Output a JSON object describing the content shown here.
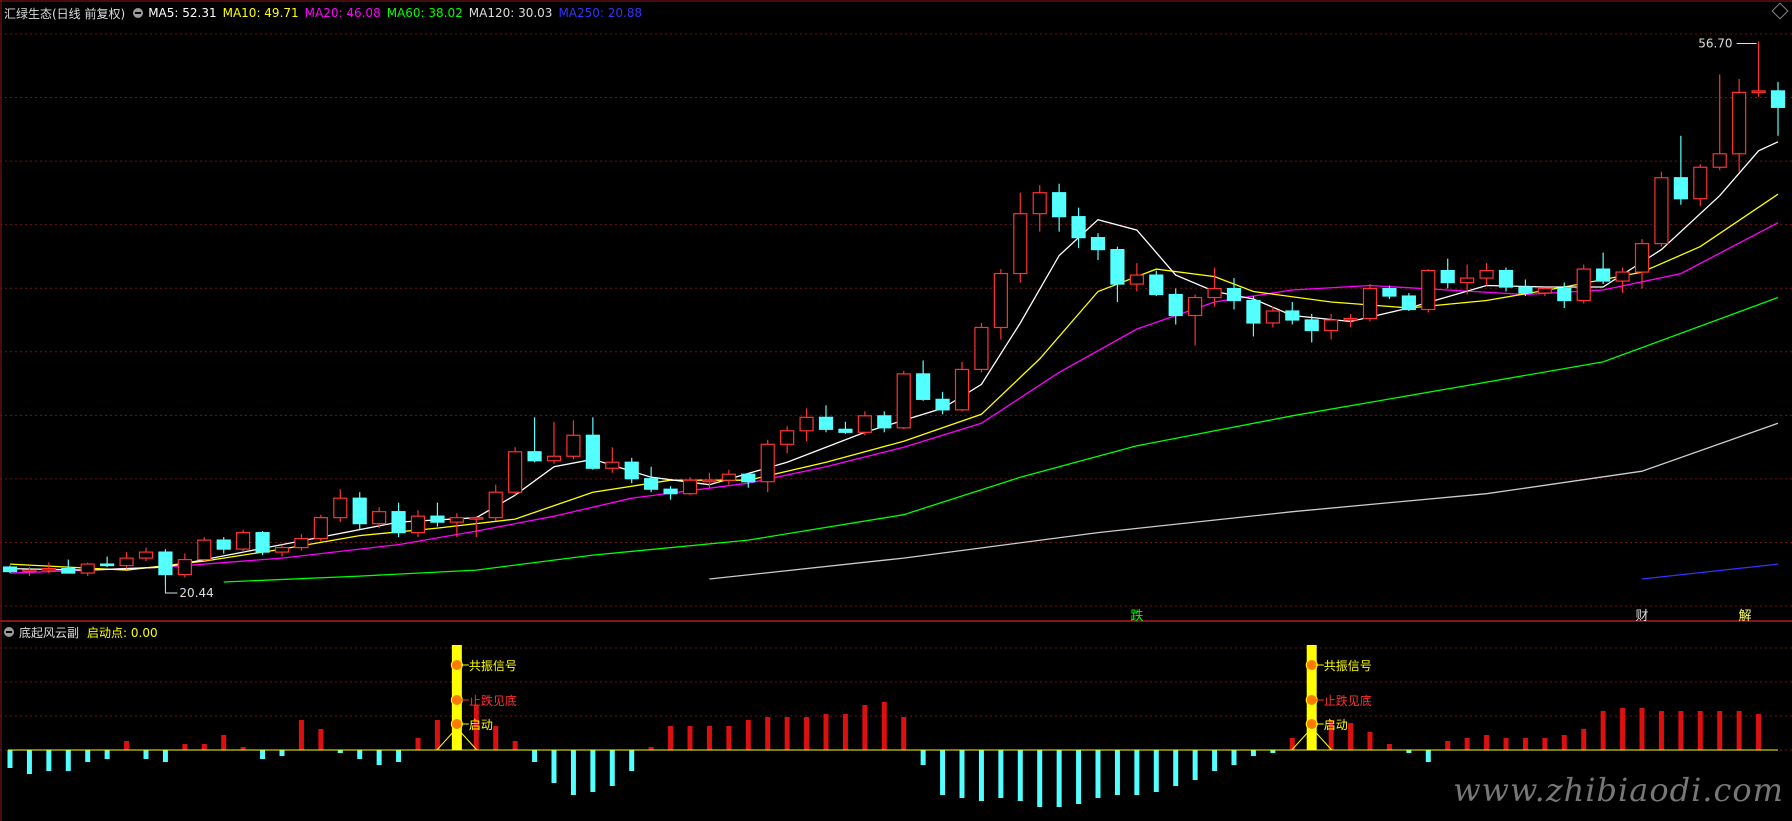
{
  "main_panel": {
    "stock_name": "汇绿生态(日线 前复权)",
    "ma_values": [
      {
        "label": "MA5: 52.31",
        "color": "#ffffff"
      },
      {
        "label": "MA10: 49.71",
        "color": "#ffff00"
      },
      {
        "label": "MA20: 46.08",
        "color": "#ff00ff"
      },
      {
        "label": "MA60: 38.02",
        "color": "#00ff00"
      },
      {
        "label": "MA120: 30.03",
        "color": "#dddddd"
      },
      {
        "label": "MA250: 20.88",
        "color": "#3333ff"
      }
    ],
    "high_label": "56.70",
    "low_label": "20.44",
    "event_markers": [
      "跌",
      "财",
      "解"
    ]
  },
  "sub_panel": {
    "indicator_name": "底起风云副",
    "start_point_label": "启动点: 0.00",
    "signal_labels": [
      "共振信号",
      "止跌见底",
      "启动"
    ]
  },
  "watermark": "www.zhibiaodi.com",
  "colors": {
    "up": "#ff3232",
    "down": "#54ffff",
    "ma5": "#ffffff",
    "ma10": "#ffff00",
    "ma20": "#ff00ff",
    "ma60": "#00ff00",
    "ma120": "#cccccc",
    "ma250": "#3333ff",
    "grid": "#6e1515"
  },
  "chart_data": {
    "type": "candlestick",
    "y_range": [
      19,
      58
    ],
    "candles": [
      [
        21.6,
        21.7,
        21.2,
        21.3
      ],
      [
        21.3,
        21.6,
        21.0,
        21.4
      ],
      [
        21.4,
        21.9,
        21.2,
        21.5
      ],
      [
        21.5,
        22.1,
        21.3,
        21.2
      ],
      [
        21.2,
        21.9,
        21.0,
        21.8
      ],
      [
        21.8,
        22.3,
        21.6,
        21.7
      ],
      [
        21.7,
        22.6,
        21.5,
        22.2
      ],
      [
        22.2,
        22.9,
        22.0,
        22.6
      ],
      [
        22.6,
        22.8,
        20.4,
        21.1
      ],
      [
        21.1,
        22.5,
        20.9,
        22.1
      ],
      [
        22.1,
        23.6,
        22.0,
        23.4
      ],
      [
        23.4,
        23.6,
        22.5,
        22.8
      ],
      [
        22.8,
        24.1,
        22.6,
        23.9
      ],
      [
        23.9,
        24.0,
        22.4,
        22.6
      ],
      [
        22.6,
        23.1,
        22.3,
        22.9
      ],
      [
        22.9,
        23.8,
        22.7,
        23.5
      ],
      [
        23.5,
        25.1,
        23.3,
        24.9
      ],
      [
        24.9,
        26.8,
        24.6,
        26.2
      ],
      [
        26.2,
        26.6,
        24.1,
        24.5
      ],
      [
        24.5,
        25.6,
        24.2,
        25.3
      ],
      [
        25.3,
        25.9,
        23.6,
        23.9
      ],
      [
        23.9,
        25.4,
        23.6,
        25.0
      ],
      [
        25.0,
        25.9,
        24.3,
        24.6
      ],
      [
        24.6,
        25.2,
        23.6,
        24.9
      ],
      [
        24.9,
        25.0,
        23.6,
        24.9
      ],
      [
        24.9,
        27.1,
        24.7,
        26.6
      ],
      [
        26.6,
        29.6,
        26.4,
        29.3
      ],
      [
        29.3,
        31.6,
        28.6,
        28.7
      ],
      [
        28.7,
        31.3,
        28.5,
        29.0
      ],
      [
        29.0,
        31.4,
        28.8,
        30.4
      ],
      [
        30.4,
        31.6,
        28.1,
        28.2
      ],
      [
        28.2,
        29.6,
        27.9,
        28.6
      ],
      [
        28.6,
        28.9,
        27.2,
        27.5
      ],
      [
        27.5,
        28.3,
        26.6,
        26.8
      ],
      [
        26.8,
        27.0,
        26.1,
        26.5
      ],
      [
        26.5,
        27.6,
        26.4,
        27.4
      ],
      [
        27.4,
        27.9,
        26.9,
        27.4
      ],
      [
        27.4,
        28.1,
        27.1,
        27.8
      ],
      [
        27.8,
        27.9,
        26.9,
        27.3
      ],
      [
        27.3,
        30.1,
        26.6,
        29.8
      ],
      [
        29.8,
        31.0,
        29.2,
        30.7
      ],
      [
        30.7,
        32.2,
        30.0,
        31.6
      ],
      [
        31.6,
        32.4,
        30.6,
        30.8
      ],
      [
        30.8,
        31.3,
        30.5,
        30.6
      ],
      [
        30.6,
        32.0,
        30.4,
        31.7
      ],
      [
        31.7,
        32.0,
        30.6,
        30.9
      ],
      [
        30.9,
        34.7,
        30.8,
        34.5
      ],
      [
        34.5,
        35.4,
        32.7,
        32.8
      ],
      [
        32.8,
        33.3,
        31.8,
        32.1
      ],
      [
        32.1,
        35.3,
        32.0,
        34.8
      ],
      [
        34.8,
        37.9,
        34.6,
        37.6
      ],
      [
        37.6,
        41.5,
        36.8,
        41.2
      ],
      [
        41.2,
        46.6,
        40.6,
        45.2
      ],
      [
        45.2,
        47.1,
        44.0,
        46.6
      ],
      [
        46.6,
        47.2,
        44.0,
        45.0
      ],
      [
        45.0,
        45.6,
        42.9,
        43.6
      ],
      [
        43.6,
        43.9,
        42.1,
        42.8
      ],
      [
        42.8,
        43.0,
        39.3,
        40.5
      ],
      [
        40.5,
        41.9,
        40.0,
        41.1
      ],
      [
        41.1,
        41.4,
        39.7,
        39.8
      ],
      [
        39.8,
        40.2,
        37.8,
        38.4
      ],
      [
        38.4,
        39.8,
        36.4,
        39.6
      ],
      [
        39.6,
        41.6,
        39.0,
        40.2
      ],
      [
        40.2,
        40.9,
        38.8,
        39.4
      ],
      [
        39.4,
        39.7,
        37.0,
        37.9
      ],
      [
        37.9,
        39.0,
        37.6,
        38.7
      ],
      [
        38.7,
        39.3,
        37.8,
        38.1
      ],
      [
        38.1,
        38.5,
        36.6,
        37.4
      ],
      [
        37.4,
        38.5,
        36.8,
        38.1
      ],
      [
        38.1,
        38.5,
        37.6,
        38.2
      ],
      [
        38.2,
        40.5,
        38.0,
        40.2
      ],
      [
        40.2,
        40.4,
        39.5,
        39.7
      ],
      [
        39.7,
        39.9,
        38.7,
        38.8
      ],
      [
        38.8,
        41.5,
        38.6,
        41.4
      ],
      [
        41.4,
        42.2,
        40.2,
        40.6
      ],
      [
        40.6,
        41.8,
        39.8,
        40.9
      ],
      [
        40.9,
        41.9,
        40.4,
        41.4
      ],
      [
        41.4,
        41.6,
        40.0,
        40.3
      ],
      [
        40.3,
        40.8,
        39.7,
        39.9
      ],
      [
        39.9,
        40.2,
        39.7,
        40.2
      ],
      [
        40.2,
        40.6,
        38.9,
        39.4
      ],
      [
        39.4,
        41.8,
        39.2,
        41.5
      ],
      [
        41.5,
        42.6,
        40.5,
        40.7
      ],
      [
        40.7,
        41.6,
        39.9,
        41.3
      ],
      [
        41.3,
        43.5,
        40.2,
        43.2
      ],
      [
        43.2,
        48.0,
        43.0,
        47.6
      ],
      [
        47.6,
        50.4,
        45.8,
        46.2
      ],
      [
        46.2,
        48.5,
        45.7,
        48.3
      ],
      [
        48.3,
        54.5,
        48.1,
        49.2
      ],
      [
        49.2,
        54.2,
        48.0,
        53.3
      ],
      [
        53.3,
        56.7,
        53.0,
        53.4
      ],
      [
        53.4,
        54.0,
        50.4,
        52.3
      ]
    ],
    "ma5": [
      [
        0,
        21.5
      ],
      [
        4,
        21.4
      ],
      [
        8,
        21.6
      ],
      [
        12,
        22.6
      ],
      [
        16,
        23.6
      ],
      [
        20,
        24.6
      ],
      [
        24,
        24.9
      ],
      [
        26,
        26.4
      ],
      [
        28,
        28.3
      ],
      [
        30,
        28.8
      ],
      [
        33,
        27.6
      ],
      [
        36,
        27.1
      ],
      [
        40,
        28.6
      ],
      [
        44,
        30.6
      ],
      [
        48,
        32.2
      ],
      [
        50,
        33.8
      ],
      [
        52,
        37.9
      ],
      [
        54,
        42.4
      ],
      [
        56,
        44.8
      ],
      [
        58,
        44.1
      ],
      [
        60,
        41.1
      ],
      [
        62,
        40.0
      ],
      [
        64,
        39.5
      ],
      [
        66,
        38.4
      ],
      [
        69,
        38.0
      ],
      [
        72,
        38.9
      ],
      [
        76,
        40.4
      ],
      [
        79,
        40.3
      ],
      [
        82,
        40.3
      ],
      [
        85,
        42.8
      ],
      [
        88,
        46.4
      ],
      [
        90,
        49.4
      ],
      [
        91,
        50.0
      ]
    ],
    "ma10": [
      [
        0,
        21.8
      ],
      [
        6,
        21.4
      ],
      [
        10,
        22.0
      ],
      [
        14,
        22.8
      ],
      [
        18,
        23.7
      ],
      [
        22,
        24.2
      ],
      [
        26,
        24.8
      ],
      [
        30,
        26.6
      ],
      [
        34,
        27.4
      ],
      [
        38,
        27.4
      ],
      [
        42,
        28.6
      ],
      [
        46,
        30.0
      ],
      [
        50,
        31.8
      ],
      [
        53,
        35.5
      ],
      [
        56,
        40.0
      ],
      [
        59,
        41.5
      ],
      [
        62,
        41.0
      ],
      [
        64,
        40.0
      ],
      [
        68,
        39.3
      ],
      [
        72,
        38.9
      ],
      [
        76,
        39.4
      ],
      [
        80,
        40.3
      ],
      [
        84,
        41.3
      ],
      [
        87,
        43.0
      ],
      [
        91,
        46.5
      ]
    ],
    "ma20": [
      [
        0,
        21.2
      ],
      [
        8,
        21.6
      ],
      [
        14,
        22.2
      ],
      [
        20,
        23.1
      ],
      [
        24,
        24.0
      ],
      [
        28,
        25.0
      ],
      [
        32,
        26.2
      ],
      [
        38,
        27.2
      ],
      [
        42,
        28.3
      ],
      [
        46,
        29.6
      ],
      [
        50,
        31.2
      ],
      [
        54,
        34.6
      ],
      [
        58,
        37.5
      ],
      [
        62,
        39.3
      ],
      [
        66,
        40.1
      ],
      [
        70,
        40.4
      ],
      [
        74,
        40.1
      ],
      [
        78,
        39.8
      ],
      [
        82,
        40.1
      ],
      [
        86,
        41.2
      ],
      [
        91,
        44.6
      ]
    ],
    "ma60": [
      [
        11,
        20.6
      ],
      [
        18,
        21.0
      ],
      [
        24,
        21.4
      ],
      [
        30,
        22.4
      ],
      [
        38,
        23.4
      ],
      [
        46,
        25.1
      ],
      [
        52,
        27.6
      ],
      [
        58,
        29.7
      ],
      [
        66,
        31.7
      ],
      [
        74,
        33.5
      ],
      [
        82,
        35.3
      ],
      [
        91,
        39.6
      ]
    ],
    "ma120": [
      [
        36,
        20.8
      ],
      [
        46,
        22.2
      ],
      [
        56,
        23.9
      ],
      [
        66,
        25.3
      ],
      [
        76,
        26.5
      ],
      [
        84,
        28.0
      ],
      [
        91,
        31.2
      ]
    ],
    "ma250": [
      [
        84,
        20.8
      ],
      [
        91,
        21.8
      ]
    ],
    "histogram": [
      -6,
      -8,
      -7,
      -7,
      -4,
      -3,
      3,
      -3,
      -4,
      2,
      2,
      5,
      1,
      -3,
      -2,
      10,
      7,
      -1,
      -3,
      -5,
      -4,
      4,
      10,
      13,
      15,
      8,
      3,
      -4,
      -11,
      -15,
      -14,
      -12,
      -7,
      1,
      8,
      8,
      8,
      8,
      10,
      11,
      11,
      11,
      12,
      12,
      15,
      16,
      11,
      -5,
      -15,
      -16,
      -17,
      -16,
      -17,
      -19,
      -19,
      -18,
      -16,
      -15,
      -15,
      -14,
      -12,
      -10,
      -7,
      -5,
      -2,
      -1,
      4,
      10,
      10,
      9,
      6,
      2,
      -1,
      -4,
      3,
      4,
      5,
      4,
      4,
      4,
      5,
      7,
      13,
      14,
      14,
      13,
      13,
      13,
      13,
      13,
      12
    ]
  }
}
